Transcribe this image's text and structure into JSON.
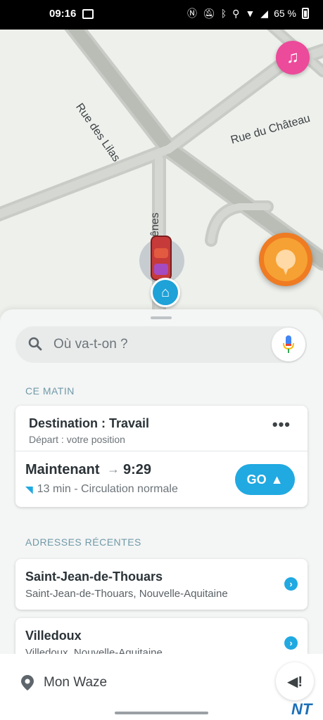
{
  "status_bar": {
    "time": "09:16",
    "battery": "65 %"
  },
  "map": {
    "streets": [
      "Rue des Lilas",
      "Rue du Château",
      "Frênes"
    ]
  },
  "search": {
    "placeholder": "Où va-t-on ?"
  },
  "sections": {
    "morning": "CE MATIN",
    "recent": "ADRESSES RÉCENTES"
  },
  "destination_card": {
    "title": "Destination : Travail",
    "subtitle": "Départ : votre position",
    "now_label": "Maintenant",
    "arrival_time": "9:29",
    "traffic": "13 min - Circulation normale",
    "go_label": "GO"
  },
  "recent": [
    {
      "title": "Saint-Jean-de-Thouars",
      "subtitle": "Saint-Jean-de-Thouars, Nouvelle-Aquitaine"
    },
    {
      "title": "Villedoux",
      "subtitle": "Villedoux, Nouvelle-Aquitaine"
    }
  ],
  "bottom_bar": {
    "my_waze": "Mon Waze",
    "watermark": "NT"
  },
  "colors": {
    "accent": "#21a9e1",
    "music": "#ec4a9a",
    "report": "#ef7b22"
  }
}
